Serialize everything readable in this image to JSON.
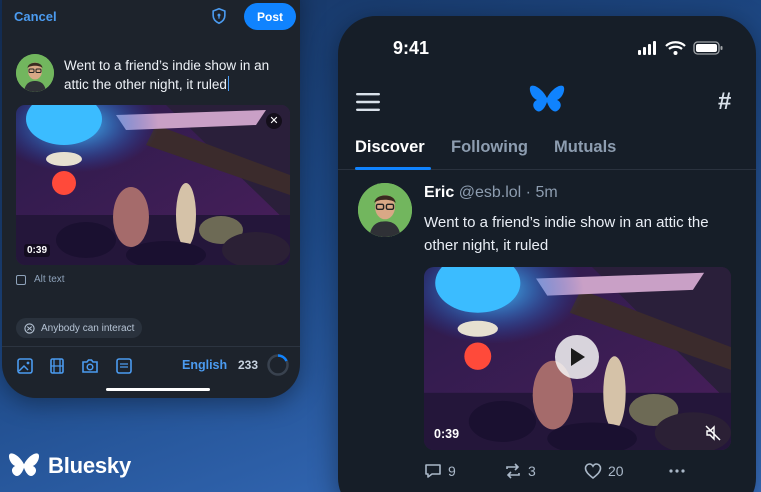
{
  "composer": {
    "cancel_label": "Cancel",
    "post_label": "Post",
    "draft_text": "Went to a friend’s indie show in an attic the other night, it ruled",
    "media_duration": "0:39",
    "alt_text_label": "Alt text",
    "interaction_label": "Anybody can interact",
    "language": "English",
    "chars_remaining": "233",
    "icons": [
      "shield-icon",
      "image-icon",
      "video-icon",
      "camera-icon",
      "gif-icon"
    ]
  },
  "feed": {
    "status_time": "9:41",
    "tabs": [
      {
        "label": "Discover",
        "active": true
      },
      {
        "label": "Following",
        "active": false
      },
      {
        "label": "Mutuals",
        "active": false
      }
    ],
    "post": {
      "author_name": "Eric",
      "author_handle": "@esb.lol",
      "separator": "·",
      "age": "5m",
      "text": "Went to a friend’s indie show in an attic the other night, it ruled",
      "media_duration": "0:39",
      "replies": "9",
      "reposts": "3",
      "likes": "20"
    }
  },
  "brand": {
    "name": "Bluesky",
    "accent_color": "#1083fe"
  }
}
